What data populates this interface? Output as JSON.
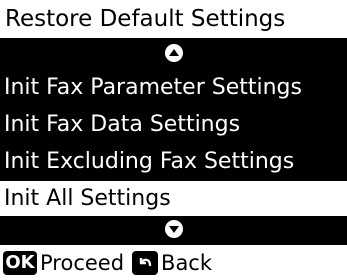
{
  "header": {
    "title": "Restore Default Settings"
  },
  "menu": {
    "items": [
      {
        "label": "Init Fax Parameter Settings"
      },
      {
        "label": "Init Fax Data Settings"
      },
      {
        "label": "Init Excluding Fax Settings"
      },
      {
        "label": "Init All Settings"
      }
    ],
    "selected_label": "Init All Settings"
  },
  "softkeys": {
    "ok_badge": "OK",
    "proceed_label": "Proceed",
    "back_label": "Back"
  },
  "icons": {
    "scroll_up": "arrow-up-icon",
    "scroll_down": "arrow-down-icon",
    "back": "back-arrow-icon"
  },
  "colors": {
    "background": "#000000",
    "highlight": "#ffffff"
  }
}
